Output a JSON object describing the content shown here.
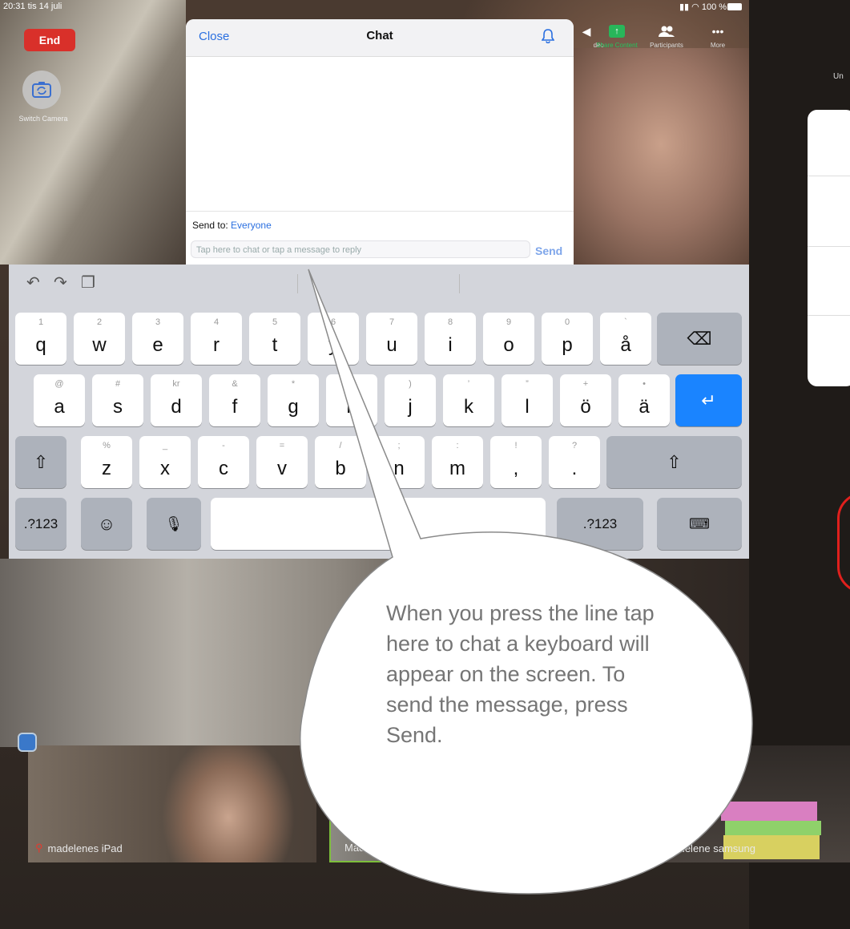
{
  "status_bar": {
    "time": "20:31  tis 14 juli",
    "right": "100 %"
  },
  "end_button": "End",
  "switch_camera_label": "Switch Camera",
  "toolbar": [
    {
      "id": "video",
      "label": "deo",
      "icon": "video-icon"
    },
    {
      "id": "share",
      "label": "Share Content",
      "icon": "share-icon"
    },
    {
      "id": "participants",
      "label": "Participants",
      "icon": "participants-icon"
    },
    {
      "id": "more",
      "label": "More",
      "icon": "more-icon"
    }
  ],
  "unmute_partial": "Un",
  "chat": {
    "close_label": "Close",
    "title": "Chat",
    "send_to_label": "Send to:",
    "send_to_value": "Everyone",
    "input_placeholder": "Tap here to chat or tap a message to reply",
    "send_label": "Send"
  },
  "keyboard": {
    "row1": [
      {
        "hint": "1",
        "key": "q"
      },
      {
        "hint": "2",
        "key": "w"
      },
      {
        "hint": "3",
        "key": "e"
      },
      {
        "hint": "4",
        "key": "r"
      },
      {
        "hint": "5",
        "key": "t"
      },
      {
        "hint": "6",
        "key": "y"
      },
      {
        "hint": "7",
        "key": "u"
      },
      {
        "hint": "8",
        "key": "i"
      },
      {
        "hint": "9",
        "key": "o"
      },
      {
        "hint": "0",
        "key": "p"
      },
      {
        "hint": "`",
        "key": "å"
      }
    ],
    "row2": [
      {
        "hint": "@",
        "key": "a"
      },
      {
        "hint": "#",
        "key": "s"
      },
      {
        "hint": "kr",
        "key": "d"
      },
      {
        "hint": "&",
        "key": "f"
      },
      {
        "hint": "*",
        "key": "g"
      },
      {
        "hint": "(",
        "key": "h"
      },
      {
        "hint": ")",
        "key": "j"
      },
      {
        "hint": "’",
        "key": "k"
      },
      {
        "hint": "”",
        "key": "l"
      },
      {
        "hint": "+",
        "key": "ö"
      },
      {
        "hint": "•",
        "key": "ä"
      }
    ],
    "row3": [
      {
        "hint": "%",
        "key": "z"
      },
      {
        "hint": "_",
        "key": "x"
      },
      {
        "hint": "-",
        "key": "c"
      },
      {
        "hint": "=",
        "key": "v"
      },
      {
        "hint": "/",
        "key": "b"
      },
      {
        "hint": ";",
        "key": "n"
      },
      {
        "hint": ":",
        "key": "m"
      },
      {
        "hint": "!",
        "key": ","
      },
      {
        "hint": "?",
        "key": "."
      }
    ],
    "numbers_label": ".?123"
  },
  "participants": [
    {
      "name": "madelenes iPad",
      "muted": true
    },
    {
      "name": "Madelene Segertoft",
      "muted": false
    },
    {
      "name": "Madelene samsung",
      "muted": true
    }
  ],
  "callout_text": "When you press the line tap here to chat a keyboard will appear on the screen. To send the message, press Send."
}
